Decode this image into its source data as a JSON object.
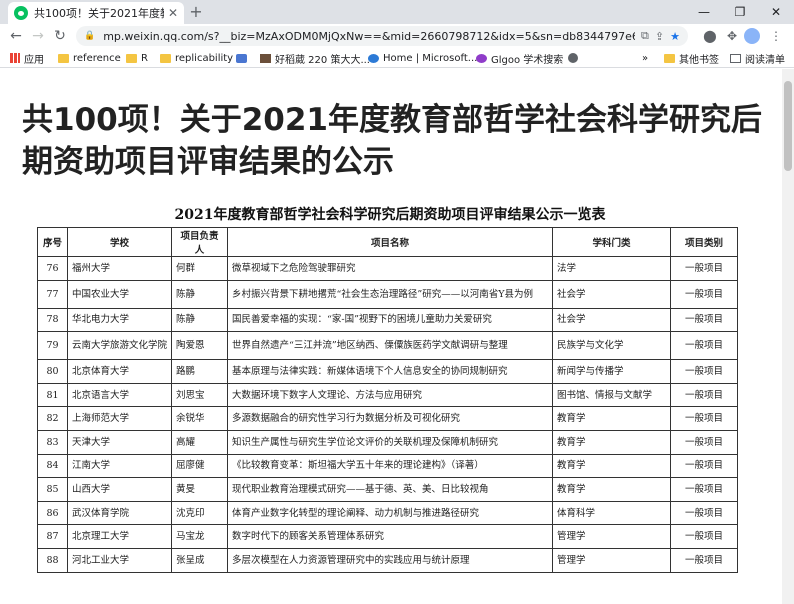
{
  "browser": {
    "tab_title": "共100项！关于2021年度教育部哲...",
    "tab_close": "✕",
    "new_tab": "+",
    "window_controls": [
      "—",
      "❐",
      "✕"
    ],
    "url": "mp.weixin.qq.com/s?__biz=MzAxODM0MjQxNw==&mid=2660798712&idx=5&sn=db8344797e6a490cf...",
    "bookmarks": [
      {
        "label": "应用",
        "icon": "apps-grid-icon"
      },
      {
        "label": "reference",
        "icon": "folder-icon"
      },
      {
        "label": "R",
        "icon": "folder-icon"
      },
      {
        "label": "replicability",
        "icon": "folder-icon"
      },
      {
        "label": "",
        "icon": "site-icon"
      },
      {
        "label": "好稻葳 220 策大大...",
        "icon": "photo-icon"
      },
      {
        "label": "Home | Microsoft...",
        "icon": "microsoft-icon"
      },
      {
        "label": "Glgoo 学术搜索",
        "icon": "glgoo-icon"
      },
      {
        "label": "",
        "icon": "globe-icon"
      },
      {
        "label": "»",
        "icon": ""
      },
      {
        "label": "其他书签",
        "icon": "folder-icon"
      },
      {
        "label": "阅读清单",
        "icon": "reading-list-icon"
      }
    ]
  },
  "article": {
    "title": "共100项！关于2021年度教育部哲学社会科学研究后期资助项目评审结果的公示",
    "doc_title": "2021年度教育部哲学社会科学研究后期资助项目评审结果公示一览表",
    "columns": [
      "序号",
      "学校",
      "项目负责人",
      "项目名称",
      "学科门类",
      "项目类别"
    ],
    "rows": [
      [
        "76",
        "福州大学",
        "何群",
        "微草视域下之危险驾驶罪研究",
        "法学",
        "一般项目"
      ],
      [
        "77",
        "中国农业大学",
        "陈静",
        "乡村振兴背景下耕地撂荒“社会生态治理路径”研究——以河南省Y县为例",
        "社会学",
        "一般项目"
      ],
      [
        "78",
        "华北电力大学",
        "陈静",
        "国民善爱幸福的实现：“家-国”视野下的困境儿童助力关爱研究",
        "社会学",
        "一般项目"
      ],
      [
        "79",
        "云南大学旅游文化学院",
        "陶爱恩",
        "世界自然遗产“三江并流”地区纳西、傈僳族医药学文献调研与整理",
        "民族学与文化学",
        "一般项目"
      ],
      [
        "80",
        "北京体育大学",
        "路鹏",
        "基本原理与法律实践：新媒体语境下个人信息安全的协同规制研究",
        "新闻学与传播学",
        "一般项目"
      ],
      [
        "81",
        "北京语言大学",
        "刘思宝",
        "大数据环境下数字人文理论、方法与应用研究",
        "图书馆、情报与文献学",
        "一般项目"
      ],
      [
        "82",
        "上海师范大学",
        "余锐华",
        "多源数据融合的研究性学习行为数据分析及可视化研究",
        "教育学",
        "一般项目"
      ],
      [
        "83",
        "天津大学",
        "高耀",
        "知识生产属性与研究生学位论文评价的关联机理及保障机制研究",
        "教育学",
        "一般项目"
      ],
      [
        "84",
        "江南大学",
        "屈廖健",
        "《比较教育变革：斯坦福大学五十年来的理论建构》（译著）",
        "教育学",
        "一般项目"
      ],
      [
        "85",
        "山西大学",
        "黄旻",
        "现代职业教育治理模式研究——基于德、英、美、日比较视角",
        "教育学",
        "一般项目"
      ],
      [
        "86",
        "武汉体育学院",
        "沈克印",
        "体育产业数字化转型的理论阐释、动力机制与推进路径研究",
        "体育科学",
        "一般项目"
      ],
      [
        "87",
        "北京理工大学",
        "马宝龙",
        "数字时代下的顾客关系管理体系研究",
        "管理学",
        "一般项目"
      ],
      [
        "88",
        "河北工业大学",
        "张呈成",
        "多层次模型在人力资源管理研究中的实践应用与统计原理",
        "管理学",
        "一般项目"
      ]
    ]
  }
}
